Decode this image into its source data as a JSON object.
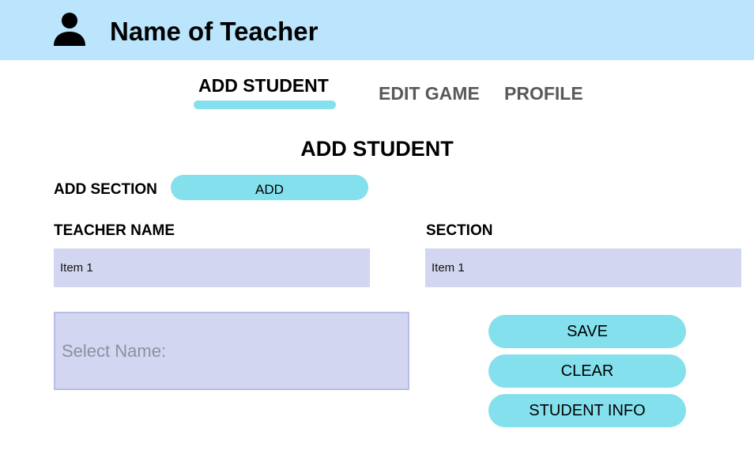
{
  "header": {
    "title": "Name of Teacher",
    "icon": "user-icon",
    "background": "#bbe5fd"
  },
  "tabs": [
    {
      "label": "ADD STUDENT",
      "active": true
    },
    {
      "label": "EDIT GAME",
      "active": false
    },
    {
      "label": "PROFILE",
      "active": false
    }
  ],
  "page_title": "ADD STUDENT",
  "add_section": {
    "label": "ADD SECTION",
    "button_label": "ADD"
  },
  "teacher_name": {
    "label": "TEACHER NAME",
    "value": "Item 1"
  },
  "section": {
    "label": "SECTION",
    "value": "Item 1"
  },
  "name_select": {
    "placeholder": "Select Name:"
  },
  "actions": {
    "save_label": "SAVE",
    "clear_label": "CLEAR",
    "student_info_label": "STUDENT INFO"
  },
  "colors": {
    "accent": "#84e0ec",
    "field_background": "#d3d6f0",
    "inactive_tab": "#595959"
  }
}
